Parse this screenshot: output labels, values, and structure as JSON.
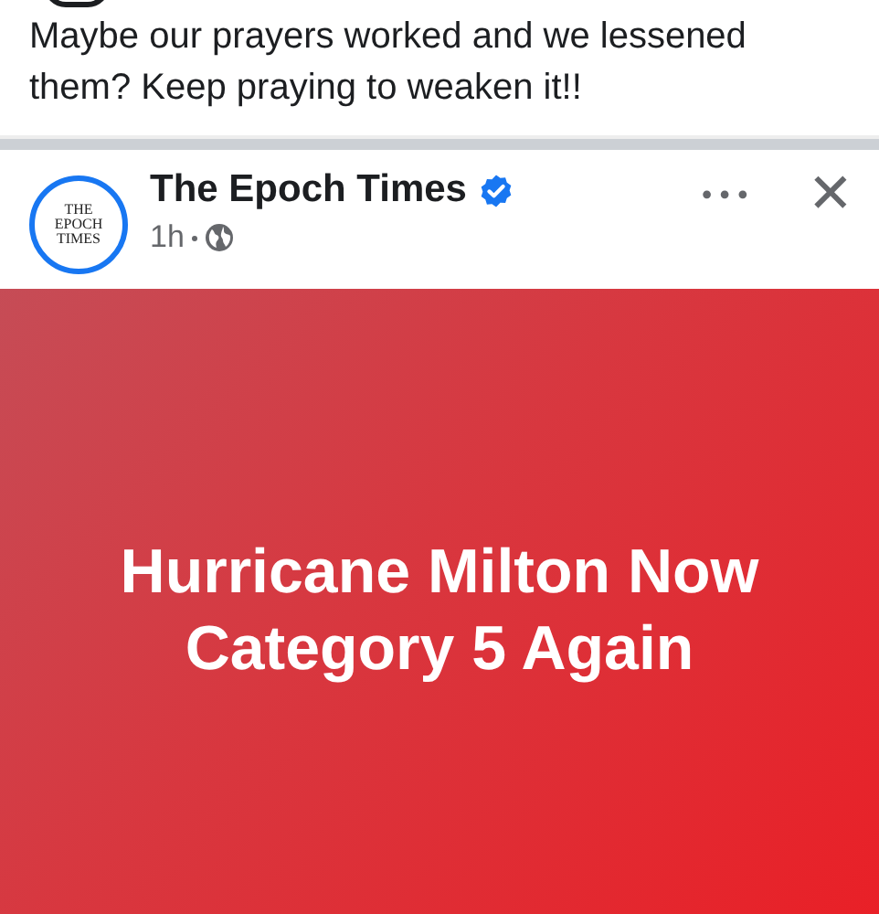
{
  "post_text": "Maybe our prayers worked and we lessened them? Keep praying to weaken it!!",
  "shared_post": {
    "avatar_lines": [
      "THE",
      "EPOCH",
      "TIMES"
    ],
    "author": "The Epoch Times",
    "verified": true,
    "time": "1h",
    "more": "•••",
    "close": "✕",
    "headline": "Hurricane Milton Now Category 5 Again"
  }
}
